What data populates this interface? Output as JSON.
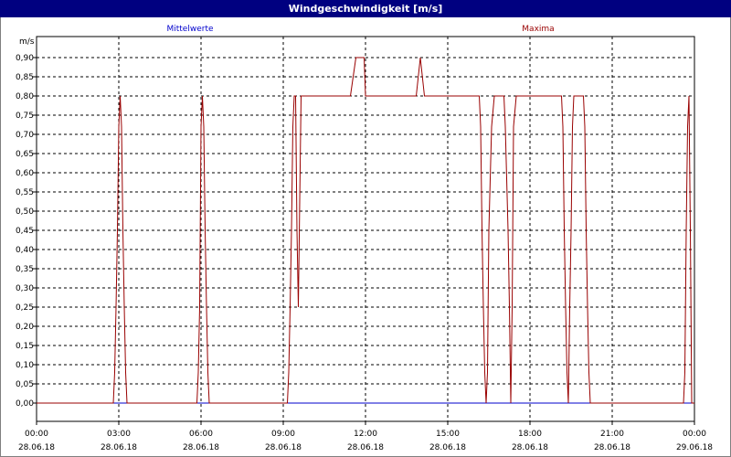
{
  "window": {
    "title": "Windgeschwindigkeit [m/s]"
  },
  "chart_data": {
    "type": "line",
    "title": "Windgeschwindigkeit [m/s]",
    "ylabel": "m/s",
    "xlabel": "",
    "grid": true,
    "ylim": [
      0,
      0.95
    ],
    "xlim_hours": [
      0,
      24
    ],
    "legend_labels": [
      "Mittelwerte",
      "Maxima"
    ],
    "y_ticks": [
      "0,00",
      "0,05",
      "0,10",
      "0,15",
      "0,20",
      "0,25",
      "0,30",
      "0,35",
      "0,40",
      "0,45",
      "0,50",
      "0,55",
      "0,60",
      "0,65",
      "0,70",
      "0,75",
      "0,80",
      "0,85",
      "0,90"
    ],
    "x_ticks": [
      {
        "time": "00:00",
        "date": "28.06.18"
      },
      {
        "time": "03:00",
        "date": "28.06.18"
      },
      {
        "time": "06:00",
        "date": "28.06.18"
      },
      {
        "time": "09:00",
        "date": "28.06.18"
      },
      {
        "time": "12:00",
        "date": "28.06.18"
      },
      {
        "time": "15:00",
        "date": "28.06.18"
      },
      {
        "time": "18:00",
        "date": "28.06.18"
      },
      {
        "time": "21:00",
        "date": "28.06.18"
      },
      {
        "time": "00:00",
        "date": "29.06.18"
      }
    ],
    "series": [
      {
        "name": "Mittelwerte",
        "color": "#0000cc",
        "x": [
          0,
          24
        ],
        "y": [
          0,
          0
        ]
      },
      {
        "name": "Maxima",
        "color": "#990000",
        "x": [
          0,
          2.8,
          2.85,
          2.9,
          2.95,
          3.0,
          3.05,
          3.1,
          3.15,
          3.2,
          3.25,
          3.3,
          5.85,
          5.9,
          5.95,
          6.0,
          6.05,
          6.1,
          6.15,
          6.2,
          6.25,
          6.3,
          9.15,
          9.2,
          9.25,
          9.3,
          9.35,
          9.4,
          9.45,
          9.5,
          9.55,
          9.65,
          11.45,
          11.65,
          11.95,
          12.0,
          13.85,
          14.0,
          14.15,
          16.15,
          16.2,
          16.25,
          16.3,
          16.35,
          16.4,
          16.45,
          16.5,
          16.6,
          16.7,
          17.05,
          17.1,
          17.2,
          17.25,
          17.3,
          17.35,
          17.4,
          17.5,
          17.55,
          19.15,
          19.2,
          19.25,
          19.3,
          19.35,
          19.4,
          19.45,
          19.5,
          19.55,
          19.6,
          19.65,
          19.95,
          20.0,
          20.05,
          20.1,
          20.15,
          20.2,
          20.25,
          20.3,
          20.35,
          23.6,
          23.65,
          23.7,
          23.75,
          23.8,
          23.85,
          23.9,
          24.0
        ],
        "y": [
          0,
          0,
          0.08,
          0.25,
          0.45,
          0.72,
          0.8,
          0.72,
          0.45,
          0.25,
          0.08,
          0,
          0,
          0.08,
          0.25,
          0.72,
          0.8,
          0.72,
          0.45,
          0.25,
          0.08,
          0,
          0,
          0.08,
          0.25,
          0.45,
          0.72,
          0.8,
          0.8,
          0.45,
          0.25,
          0.8,
          0.8,
          0.9,
          0.9,
          0.8,
          0.8,
          0.9,
          0.8,
          0.8,
          0.72,
          0.45,
          0.25,
          0.08,
          0,
          0.08,
          0.45,
          0.72,
          0.8,
          0.8,
          0.72,
          0.45,
          0.25,
          0,
          0.25,
          0.72,
          0.8,
          0.8,
          0.8,
          0.72,
          0.45,
          0.25,
          0.08,
          0,
          0.25,
          0.45,
          0.72,
          0.8,
          0.8,
          0.8,
          0.72,
          0.45,
          0.25,
          0.08,
          0,
          0,
          0,
          0,
          0,
          0.08,
          0.45,
          0.72,
          0.8,
          0.45,
          0,
          0
        ]
      }
    ]
  }
}
